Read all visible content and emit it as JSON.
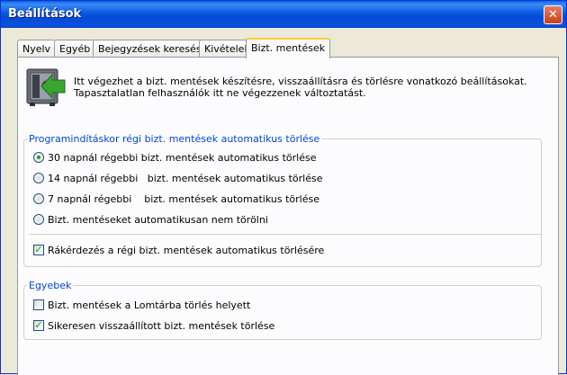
{
  "window": {
    "title": "Beállítások",
    "close_symbol": "✕"
  },
  "tabs": [
    {
      "label": "Nyelv"
    },
    {
      "label": "Egyéb"
    },
    {
      "label": "Bejegyzések keresése"
    },
    {
      "label": "Kivételek"
    },
    {
      "label": "Bizt. mentések",
      "active": true
    }
  ],
  "intro": {
    "icon": "safe-restore-icon",
    "line1": "Itt végezhet a  bizt. mentések készítésre, visszaállításra és törlésre vonatkozó beállításokat.",
    "line2": "Tapasztalatlan felhasználók itt ne végezzenek változtatást."
  },
  "auto_delete": {
    "legend": "Programindításkor régi bizt. mentések automatikus törlése",
    "options": [
      {
        "label": "30 napnál régebbi bizt. mentések automatikus törlése",
        "selected": true
      },
      {
        "label": "14 napnál régebbi   bizt. mentések automatikus törlése",
        "selected": false
      },
      {
        "label": "7 napnál régebbi    bizt. mentések automatikus törlése",
        "selected": false
      },
      {
        "label": "Bizt. mentéseket automatikusan nem törölni",
        "selected": false
      }
    ],
    "confirm": {
      "label": "Rákérdezés a régi bizt. mentések automatikus törlésére",
      "checked": true
    }
  },
  "other": {
    "legend": "Egyebek",
    "options": [
      {
        "label": "Bizt. mentések a Lomtárba törlés helyett",
        "checked": false
      },
      {
        "label": "Sikeresen visszaállított bizt. mentések törlése",
        "checked": true
      }
    ]
  },
  "colors": {
    "title_bar": "#0a52de",
    "legend_text": "#0046d5",
    "active_tab_accent": "#ffc83c",
    "check_mark": "#21a121"
  }
}
